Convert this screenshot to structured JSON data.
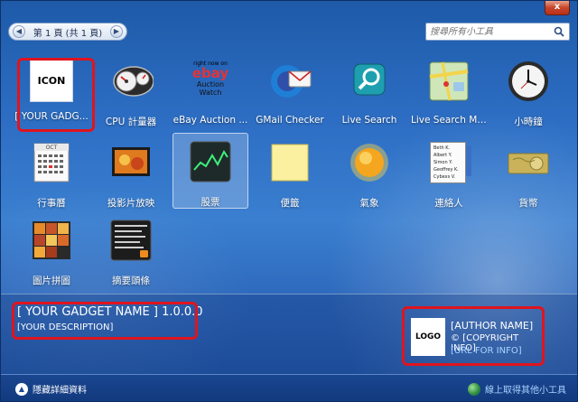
{
  "window": {
    "close_label": "x"
  },
  "pager": {
    "label": "第 1 頁 (共 1 頁)",
    "prev": "◀",
    "next": "▶"
  },
  "search": {
    "placeholder": "搜尋所有小工具",
    "icon": "search-icon"
  },
  "gadgets": [
    {
      "label": "[ YOUR GADG...",
      "icon": "icon-placeholder",
      "placeholder_text": "ICON"
    },
    {
      "label": "CPU 計量器",
      "icon": "cpu-meter-icon"
    },
    {
      "label": "eBay Auction ...",
      "icon": "ebay-icon",
      "badge_top": "right now on",
      "badge_brand": "ebay",
      "badge_sub1": "Auction",
      "badge_sub2": "Watch"
    },
    {
      "label": "GMail Checker",
      "icon": "gmail-icon"
    },
    {
      "label": "Live Search",
      "icon": "magnifier-icon"
    },
    {
      "label": "Live Search Ma...",
      "icon": "map-icon"
    },
    {
      "label": "小時鐘",
      "icon": "clock-icon"
    },
    {
      "label": "行事曆",
      "icon": "calendar-icon",
      "cal_month": "OCT"
    },
    {
      "label": "投影片放映",
      "icon": "slideshow-icon"
    },
    {
      "label": "股票",
      "icon": "stocks-icon"
    },
    {
      "label": "便籤",
      "icon": "notes-icon"
    },
    {
      "label": "氣象",
      "icon": "weather-sun-icon"
    },
    {
      "label": "連絡人",
      "icon": "contacts-icon",
      "contacts": [
        "Beth K.",
        "Albert Y.",
        "Simon Y.",
        "Geoffrey K.",
        "Cybexs V."
      ]
    },
    {
      "label": "貨幣",
      "icon": "currency-icon"
    },
    {
      "label": "圖片拼圖",
      "icon": "puzzle-icon"
    },
    {
      "label": "摘要頭條",
      "icon": "feed-headlines-icon"
    }
  ],
  "details": {
    "gadget_name": "[ YOUR GADGET NAME ] 1.0.0.0",
    "description": "[YOUR DESCRIPTION]",
    "logo": "LOGO",
    "author": "[AUTHOR NAME]",
    "copyright": "© [COPYRIGHT INFO]",
    "url": "[URL FOR INFO]"
  },
  "footer": {
    "toggle_label": "隱藏詳細資料",
    "online_label": "線上取得其他小工具"
  },
  "colors": {
    "highlight": "#e0141e",
    "link": "#a9d4ff",
    "background": "#2d6ec4"
  }
}
